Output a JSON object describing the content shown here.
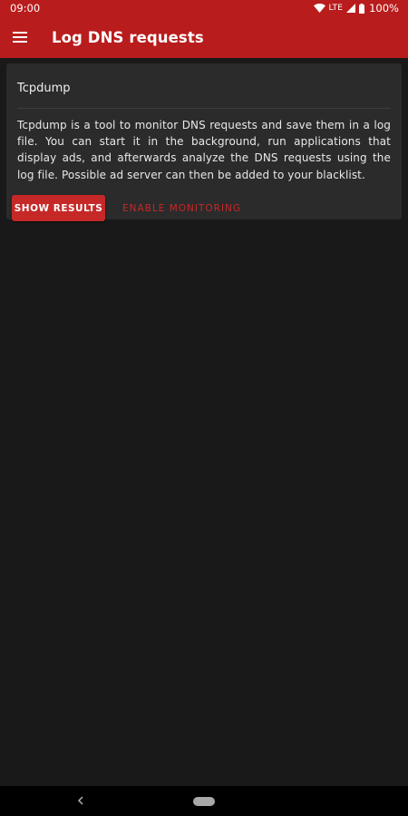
{
  "status_bar": {
    "time": "09:00",
    "network": "LTE",
    "battery": "100%"
  },
  "app_bar": {
    "title": "Log DNS requests"
  },
  "card": {
    "title": "Tcpdump",
    "description": "Tcpdump is a tool to monitor DNS requests and save them in a log file. You can start it in the background, run applications that display ads, and afterwards analyze the DNS requests using the log file. Possible ad server can then be added to your blacklist.",
    "show_results_label": "SHOW RESULTS",
    "enable_monitoring_label": "ENABLE MONITORING"
  },
  "icons": {
    "menu": "hamburger-menu-icon",
    "wifi": "wifi-icon",
    "signal": "cell-signal-icon",
    "battery": "battery-icon",
    "back": "back-chevron-icon"
  },
  "colors": {
    "primary": "#b91c1c",
    "accent": "#c62828",
    "background": "#191919",
    "card": "#2b2b2b"
  }
}
